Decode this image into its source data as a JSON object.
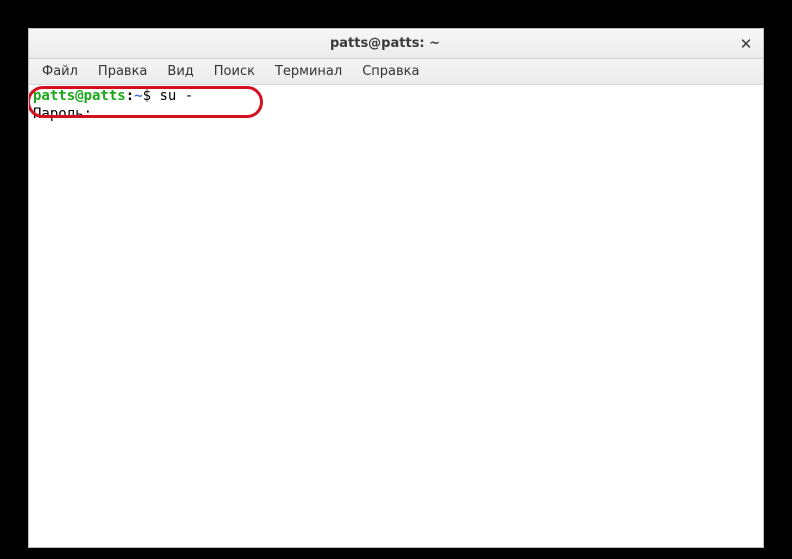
{
  "title": "patts@patts: ~",
  "menu": {
    "file": "Файл",
    "edit": "Правка",
    "view": "Вид",
    "search": "Поиск",
    "terminal": "Терминал",
    "help": "Справка"
  },
  "prompt": {
    "user_host": "patts@patts",
    "separator": ":",
    "path": "~",
    "symbol": "$ "
  },
  "command": "su -",
  "password_prompt": "Пароль: ",
  "icons": {
    "close": "✕"
  }
}
